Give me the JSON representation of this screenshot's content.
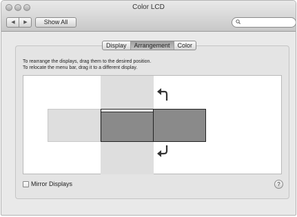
{
  "window": {
    "title": "Color LCD"
  },
  "toolbar": {
    "back_glyph": "◀",
    "forward_glyph": "▶",
    "show_all_label": "Show All",
    "search": {
      "value": "",
      "icon": "search-icon"
    }
  },
  "tabs": [
    {
      "label": "Display",
      "selected": false
    },
    {
      "label": "Arrangement",
      "selected": true
    },
    {
      "label": "Color",
      "selected": false
    }
  ],
  "instructions": [
    "To rearrange the displays, drag them to the desired position.",
    "To relocate the menu bar, drag it to a different display."
  ],
  "mirror": {
    "label": "Mirror Displays",
    "checked": false
  },
  "help": {
    "label": "?"
  },
  "colors": {
    "display_dark": "#8a8a8a",
    "display_light": "#dedede",
    "menubar": "#ffffff",
    "arrow": "#333333"
  }
}
